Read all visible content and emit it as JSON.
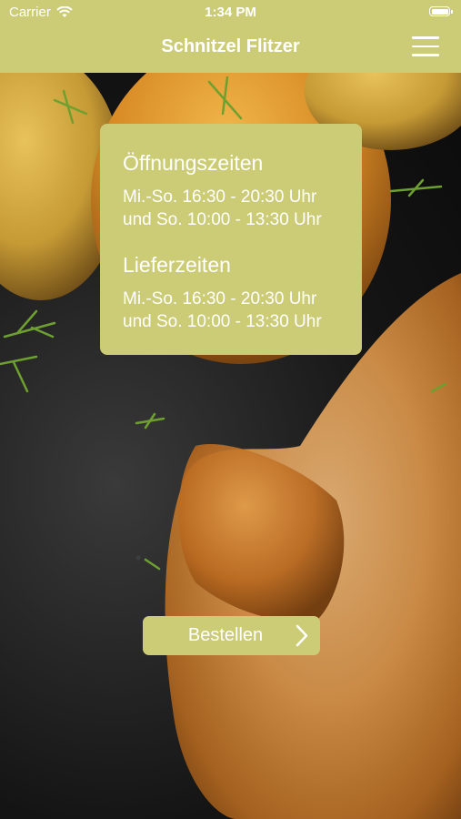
{
  "status_bar": {
    "carrier": "Carrier",
    "time": "1:34 PM",
    "wifi_icon": "wifi-icon",
    "battery_icon": "battery-icon"
  },
  "nav": {
    "title": "Schnitzel Flitzer",
    "menu_icon": "hamburger-menu-icon"
  },
  "info": {
    "opening": {
      "heading": "Öffnungszeiten",
      "lines": [
        "Mi.-So. 16:30 - 20:30 Uhr",
        "und So. 10:00 - 13:30 Uhr"
      ]
    },
    "delivery": {
      "heading": "Lieferzeiten",
      "lines": [
        "Mi.-So. 16:30 - 20:30 Uhr",
        "und So. 10:00 - 13:30 Uhr"
      ]
    }
  },
  "order_button": {
    "label": "Bestellen",
    "icon": "chevron-right-icon"
  },
  "colors": {
    "accent": "#cccc77",
    "text": "#ffffff",
    "background": "#141414"
  }
}
